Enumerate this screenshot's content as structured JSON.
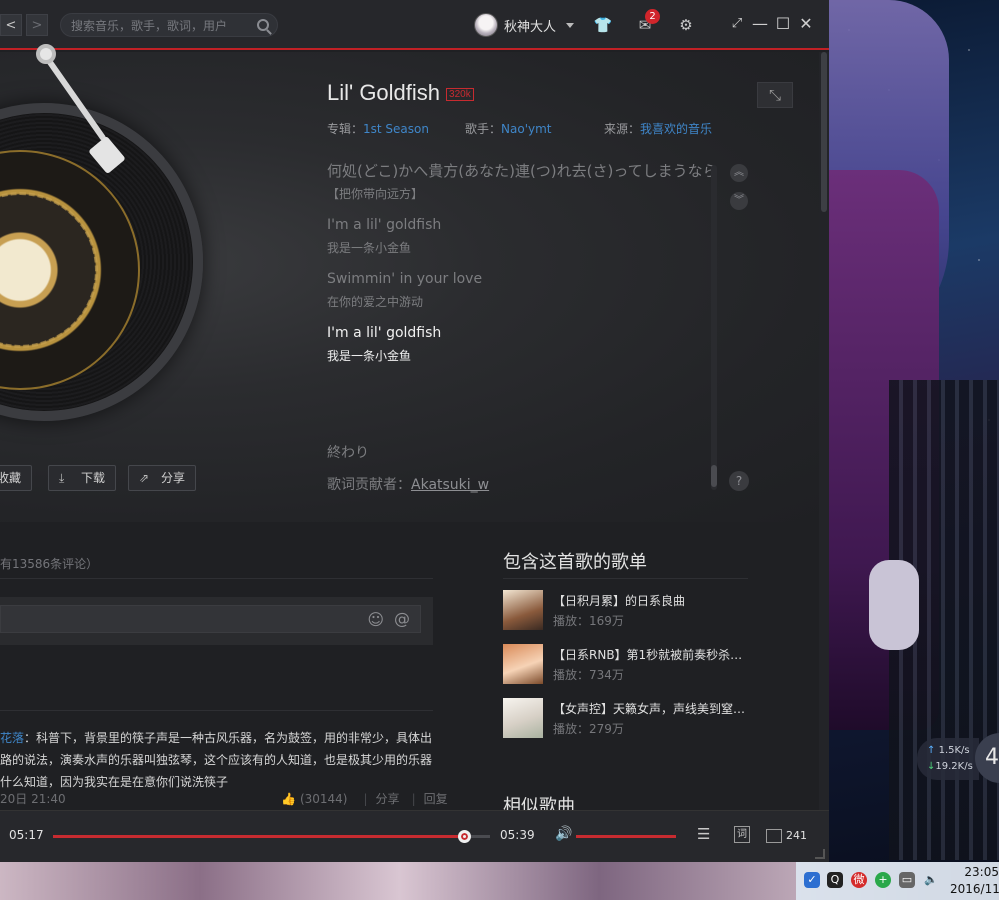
{
  "search": {
    "placeholder": "搜索音乐，歌手，歌词，用户"
  },
  "nav": {
    "back": "<",
    "forward": ">"
  },
  "user": {
    "name": "秋神大人"
  },
  "mail": {
    "badge": "2"
  },
  "song": {
    "title": "Lil' Goldfish",
    "quality": "320k",
    "album_label": "专辑：",
    "album": "1st Season",
    "artist_label": "歌手：",
    "artist": "Nao'ymt",
    "source_label": "来源：",
    "source": "我喜欢的音乐"
  },
  "lyrics": {
    "lines": [
      {
        "text": "何処(どこ)かへ貴方(あなた)連(つ)れ去(さ)ってしまうなら"
      },
      {
        "text": "【把你带向远方】"
      },
      {
        "text": "I'm a lil' goldfish"
      },
      {
        "text": "我是一条小金鱼"
      },
      {
        "text": "Swimmin' in your love"
      },
      {
        "text": "在你的爱之中游动"
      },
      {
        "text": "I'm a lil' goldfish"
      },
      {
        "text": "我是一条小金鱼"
      },
      {
        "text": "終わり"
      }
    ],
    "contributor_label": "歌词贡献者：",
    "contributor": "Akatsuki_w"
  },
  "actions": {
    "collect": "收藏",
    "download": "下载",
    "share": "分享"
  },
  "comments": {
    "count_text": "有13586条评论）",
    "comment": {
      "user": "花落",
      "line1": "：科普下，背景里的筷子声是一种古风乐器，名为鼓签，用的非常少，具体出",
      "line2": "路的说法，演奏水声的乐器叫独弦琴，这个应该有的人知道，也是极其少用的乐器",
      "line3": "什么知道，因为我实在是在意你们说洗筷子",
      "time": "20日 21:40",
      "likes": "(30144)",
      "share": "分享",
      "reply": "回复"
    }
  },
  "playlists": {
    "title": "包含这首歌的歌单",
    "items": [
      {
        "name": "【日积月累】的日系良曲",
        "plays": "播放：169万"
      },
      {
        "name": "【日系RNB】第1秒就被前奏秒杀…",
        "plays": "播放：734万"
      },
      {
        "name": "【女声控】天籁女声，声线美到窒…",
        "plays": "播放：279万"
      }
    ]
  },
  "similar": {
    "title": "相似歌曲"
  },
  "playbar": {
    "current": "05:17",
    "total": "05:39",
    "progress": 0.941,
    "volume": 1.0,
    "lyric_btn": "词",
    "queue_count": "241"
  },
  "network": {
    "up": "1.5K/s",
    "down": "19.2K/s",
    "circle": "4"
  },
  "clock": {
    "time": "23:05",
    "date": "2016/11/"
  },
  "colors": {
    "accent": "#c72b30",
    "link": "#3f86c9"
  }
}
